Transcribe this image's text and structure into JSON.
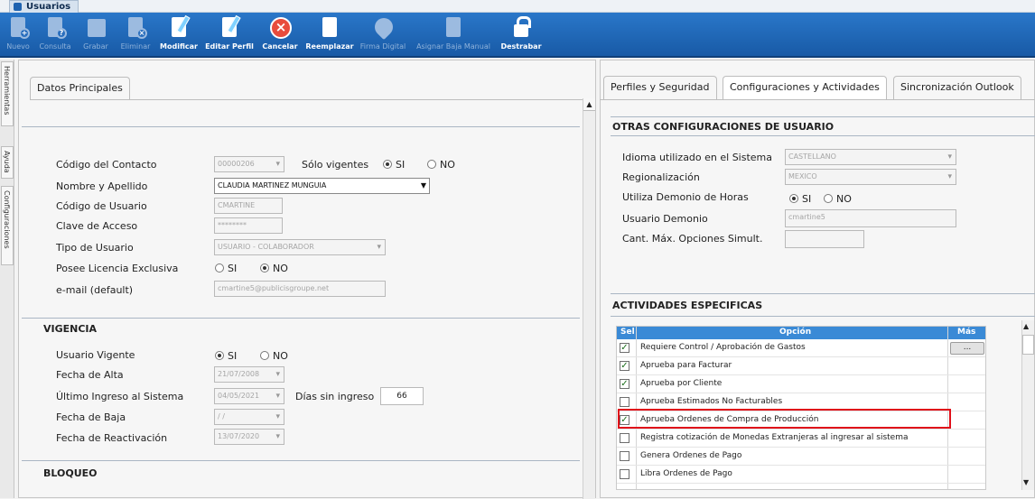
{
  "window_tab": {
    "label": "Usuarios"
  },
  "toolbar": {
    "buttons": [
      {
        "label": "Nuevo",
        "enabled": false
      },
      {
        "label": "Consulta",
        "enabled": false
      },
      {
        "label": "Grabar",
        "enabled": false
      },
      {
        "label": "Eliminar",
        "enabled": false
      },
      {
        "label": "Modificar",
        "enabled": true
      },
      {
        "label": "Editar Perfil",
        "enabled": true
      },
      {
        "label": "Cancelar",
        "enabled": true
      },
      {
        "label": "Reemplazar",
        "enabled": true
      },
      {
        "label": "Firma Digital",
        "enabled": false
      },
      {
        "label": "Asignar Baja Manual",
        "enabled": false
      },
      {
        "label": "Destrabar",
        "enabled": true
      }
    ]
  },
  "side_tabs": [
    "Herramientas",
    "Ayuda",
    "Configuraciones"
  ],
  "left": {
    "tab": "Datos Principales",
    "fields": {
      "codigo_contacto": {
        "label": "Código del Contacto",
        "value": "00000206"
      },
      "solo_vigentes": {
        "label": "Sólo vigentes",
        "si": "SI",
        "no": "NO",
        "selected": "SI"
      },
      "nombre": {
        "label": "Nombre y Apellido",
        "value": "CLAUDIA MARTINEZ MUNGUIA"
      },
      "codigo_usuario": {
        "label": "Código de Usuario",
        "value": "CMARTINE"
      },
      "clave": {
        "label": "Clave de Acceso",
        "value": "********"
      },
      "tipo": {
        "label": "Tipo de Usuario",
        "value": "USUARIO - COLABORADOR"
      },
      "licencia": {
        "label": "Posee Licencia Exclusiva",
        "si": "SI",
        "no": "NO",
        "selected": "NO"
      },
      "email": {
        "label": "e-mail (default)",
        "value": "cmartine5@publicisgroupe.net"
      }
    },
    "vigencia": {
      "title": "VIGENCIA",
      "usuario_vigente": {
        "label": "Usuario Vigente",
        "si": "SI",
        "no": "NO",
        "selected": "SI"
      },
      "fecha_alta": {
        "label": "Fecha de Alta",
        "value": "21/07/2008"
      },
      "ultimo_ingreso": {
        "label": "Último Ingreso al Sistema",
        "value": "04/05/2021"
      },
      "dias_sin_ingreso": {
        "label": "Días sin ingreso",
        "value": "66"
      },
      "fecha_baja": {
        "label": "Fecha de Baja",
        "value": " / /"
      },
      "fecha_reactivacion": {
        "label": "Fecha de Reactivación",
        "value": "13/07/2020"
      }
    },
    "bloqueo": {
      "title": "BLOQUEO"
    }
  },
  "right": {
    "tabs": [
      "Perfiles y Seguridad",
      "Configuraciones y Actividades",
      "Sincronización Outlook"
    ],
    "active_tab": "Configuraciones y Actividades",
    "otras": {
      "title": "OTRAS CONFIGURACIONES DE USUARIO",
      "idioma": {
        "label": "Idioma utilizado en el Sistema",
        "value": "CASTELLANO"
      },
      "region": {
        "label": "Regionalización",
        "value": "MEXICO"
      },
      "demonio": {
        "label": "Utiliza Demonio de Horas",
        "si": "SI",
        "no": "NO",
        "selected": "SI"
      },
      "usuario_demonio": {
        "label": "Usuario Demonio",
        "value": "cmartine5"
      },
      "cant_max": {
        "label": "Cant. Máx. Opciones Simult.",
        "value": ""
      }
    },
    "actividades": {
      "title": "ACTIVIDADES ESPECIFICAS",
      "headers": {
        "sel": "Sel",
        "opcion": "Opción",
        "mas": "Más"
      },
      "mas_button": "...",
      "rows": [
        {
          "checked": true,
          "label": "Requiere Control / Aprobación de Gastos"
        },
        {
          "checked": true,
          "label": "Aprueba para Facturar"
        },
        {
          "checked": true,
          "label": "Aprueba por Cliente"
        },
        {
          "checked": false,
          "label": "Aprueba Estimados No Facturables"
        },
        {
          "checked": true,
          "label": "Aprueba Ordenes de Compra de Producción"
        },
        {
          "checked": false,
          "label": "Registra cotización de Monedas Extranjeras al ingresar al sistema"
        },
        {
          "checked": false,
          "label": "Genera Ordenes de Pago"
        },
        {
          "checked": false,
          "label": "Libra Ordenes de Pago"
        }
      ]
    }
  }
}
